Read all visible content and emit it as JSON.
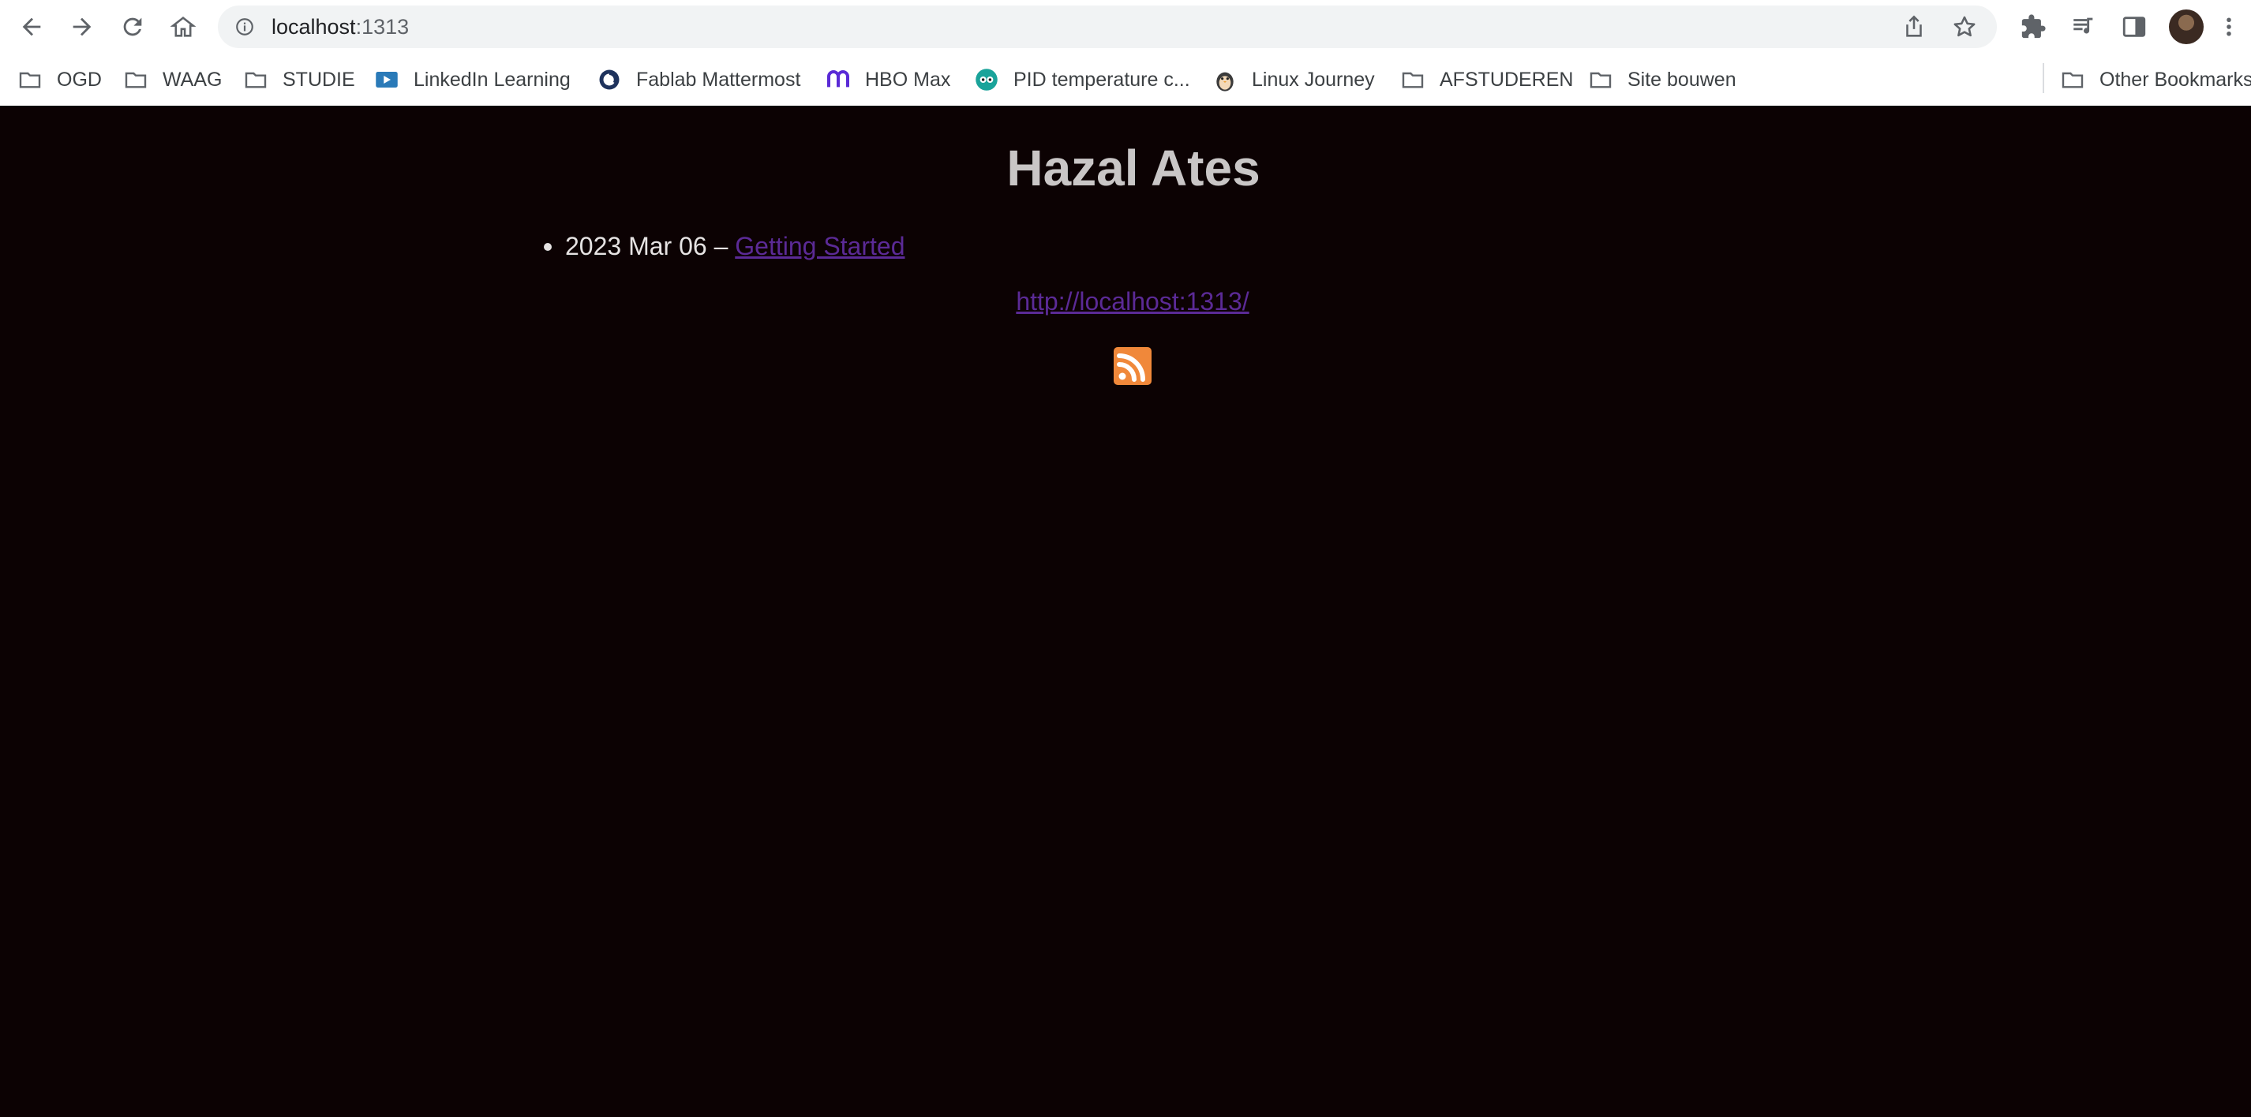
{
  "browser": {
    "address_host": "localhost",
    "address_port": ":1313",
    "bookmarks": [
      {
        "label": "OGD",
        "icon": "folder-icon"
      },
      {
        "label": "WAAG",
        "icon": "folder-icon"
      },
      {
        "label": "STUDIE",
        "icon": "folder-icon"
      },
      {
        "label": "LinkedIn Learning",
        "icon": "linkedin-learning-icon"
      },
      {
        "label": "Fablab Mattermost",
        "icon": "mattermost-icon"
      },
      {
        "label": "HBO Max",
        "icon": "hbo-max-icon"
      },
      {
        "label": "PID temperature c...",
        "icon": "owl-icon"
      },
      {
        "label": "Linux Journey",
        "icon": "penguin-icon"
      },
      {
        "label": "AFSTUDEREN",
        "icon": "folder-icon"
      },
      {
        "label": "Site bouwen",
        "icon": "folder-icon"
      }
    ],
    "other_bookmarks": "Other Bookmarks"
  },
  "page": {
    "title": "Hazal Ates",
    "posts": [
      {
        "date": "2023 Mar 06",
        "separator": "–",
        "title": "Getting Started"
      }
    ],
    "home_link": "http://localhost:1313/",
    "rss_icon": "rss-icon",
    "colors": {
      "background": "#0c0203",
      "link": "#5b2a96",
      "rss": "#f0883a"
    }
  }
}
